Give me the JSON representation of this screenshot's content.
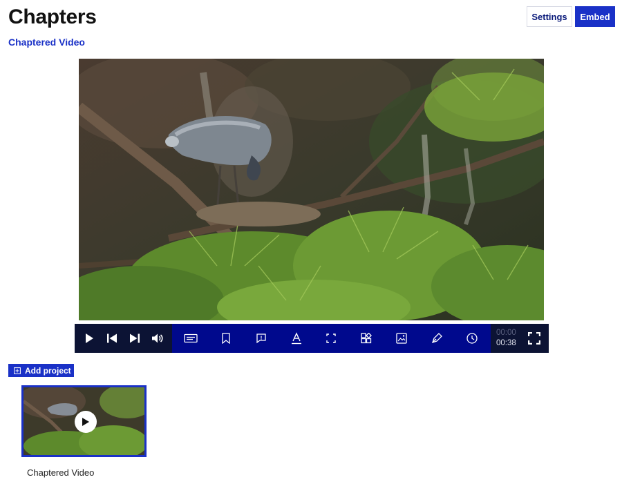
{
  "header": {
    "title": "Chapters",
    "settings_label": "Settings",
    "embed_label": "Embed"
  },
  "video": {
    "title": "Chaptered Video",
    "current_time": "00:00",
    "total_time": "00:38",
    "controls": {
      "left": [
        "play-icon",
        "previous-chapter-icon",
        "next-chapter-icon",
        "volume-icon"
      ],
      "tools": [
        "transcript-icon",
        "bookmark-icon",
        "comment-icon",
        "text-icon",
        "crop-icon",
        "widgets-icon",
        "image-icon",
        "draw-icon",
        "clock-icon"
      ],
      "right": [
        "fullscreen-icon"
      ]
    }
  },
  "projects": {
    "add_label": "Add project",
    "items": [
      {
        "label": "Chaptered Video"
      }
    ]
  },
  "colors": {
    "accent": "#1a31c7",
    "toolbar_dark": "#0c1334",
    "toolbar_blue": "#00098d"
  }
}
